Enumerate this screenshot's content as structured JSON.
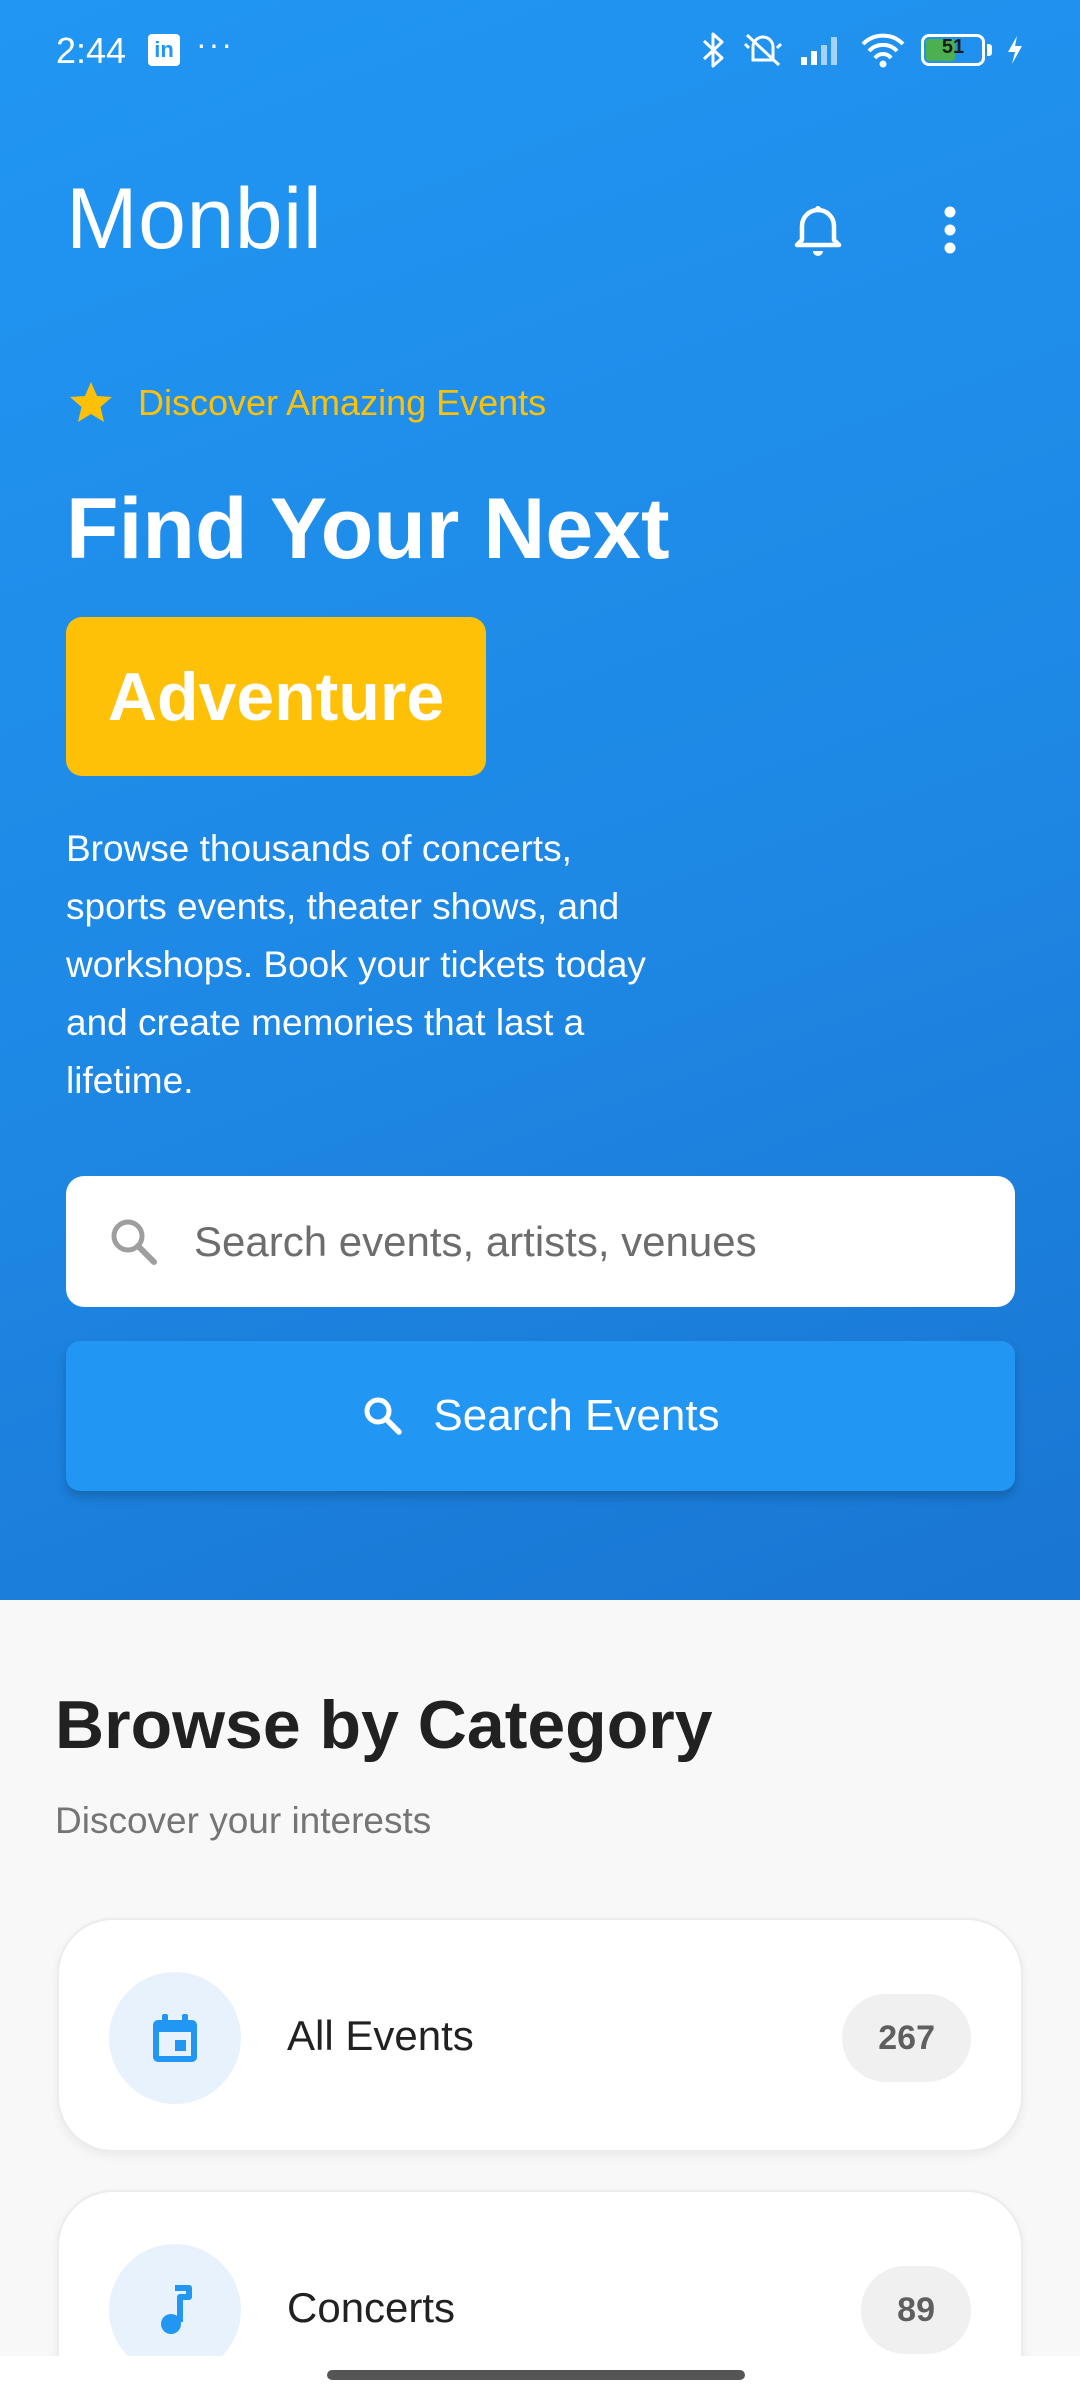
{
  "status_bar": {
    "time": "2:44",
    "notification_app": "in",
    "more": "···",
    "battery_level": "51"
  },
  "app_bar": {
    "title": "Monbil",
    "bell_icon": "bell-icon",
    "more_icon": "more-vertical-icon"
  },
  "hero": {
    "tagline": "Discover Amazing Events",
    "tagline_icon": "star-icon",
    "headline": "Find Your Next",
    "highlight": "Adventure",
    "description": "Browse thousands of concerts, sports events, theater shows, and workshops. Book your tickets today and create memories that last a lifetime.",
    "search_placeholder": "Search events, artists, venues",
    "search_button_label": "Search Events",
    "colors": {
      "hero_bg": "#2196f3",
      "accent": "#ffc107",
      "button": "#2196f3"
    }
  },
  "categories": {
    "title": "Browse by Category",
    "subtitle": "Discover your interests",
    "items": [
      {
        "label": "All Events",
        "count": "267",
        "icon": "calendar-icon"
      },
      {
        "label": "Concerts",
        "count": "89",
        "icon": "music-note-icon"
      }
    ]
  }
}
